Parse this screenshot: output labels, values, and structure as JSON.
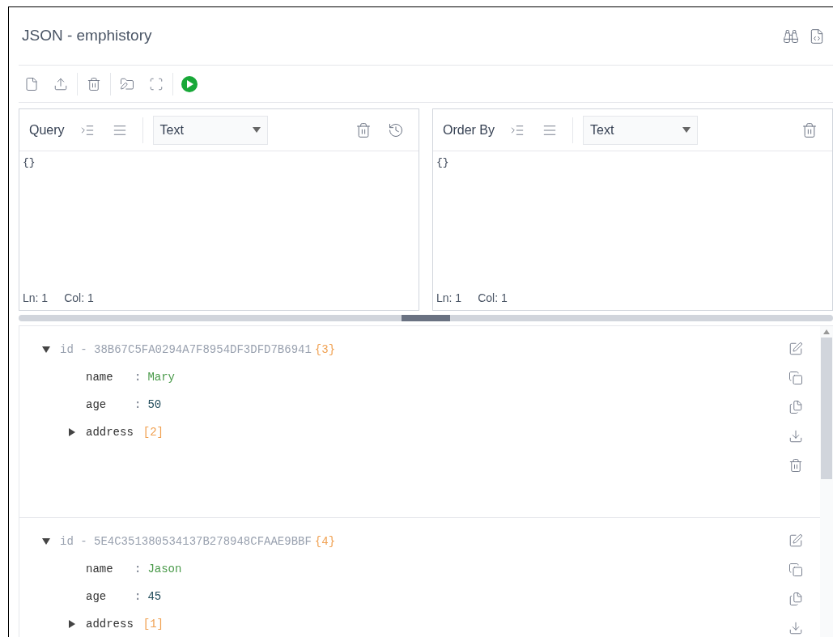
{
  "window": {
    "title": "JSON - emphistory"
  },
  "editors": [
    {
      "label": "Query",
      "format": "Text",
      "content": "{}",
      "ln": "Ln: 1",
      "col": "Col: 1",
      "history": true
    },
    {
      "label": "Order By",
      "format": "Text",
      "content": "{}",
      "ln": "Ln: 1",
      "col": "Col: 1",
      "history": false
    }
  ],
  "documents": [
    {
      "id": "id - 38B67C5FA0294A7F8954DF3DFD7B6941",
      "count": "{3}",
      "expanded": true,
      "fields": [
        {
          "kind": "string",
          "key": "name",
          "separator": ":",
          "value": "Mary"
        },
        {
          "kind": "number",
          "key": "age",
          "separator": ":",
          "value": "50"
        },
        {
          "kind": "array",
          "key": "address",
          "count": "[2]",
          "expanded": false
        }
      ]
    },
    {
      "id": "id - 5E4C351380534137B278948CFAAE9BBF",
      "count": "{4}",
      "expanded": true,
      "fields": [
        {
          "kind": "string",
          "key": "name",
          "separator": ":",
          "value": "Jason"
        },
        {
          "kind": "number",
          "key": "age",
          "separator": ":",
          "value": "45"
        },
        {
          "kind": "array",
          "key": "address",
          "count": "[1]",
          "expanded": false
        }
      ]
    }
  ]
}
